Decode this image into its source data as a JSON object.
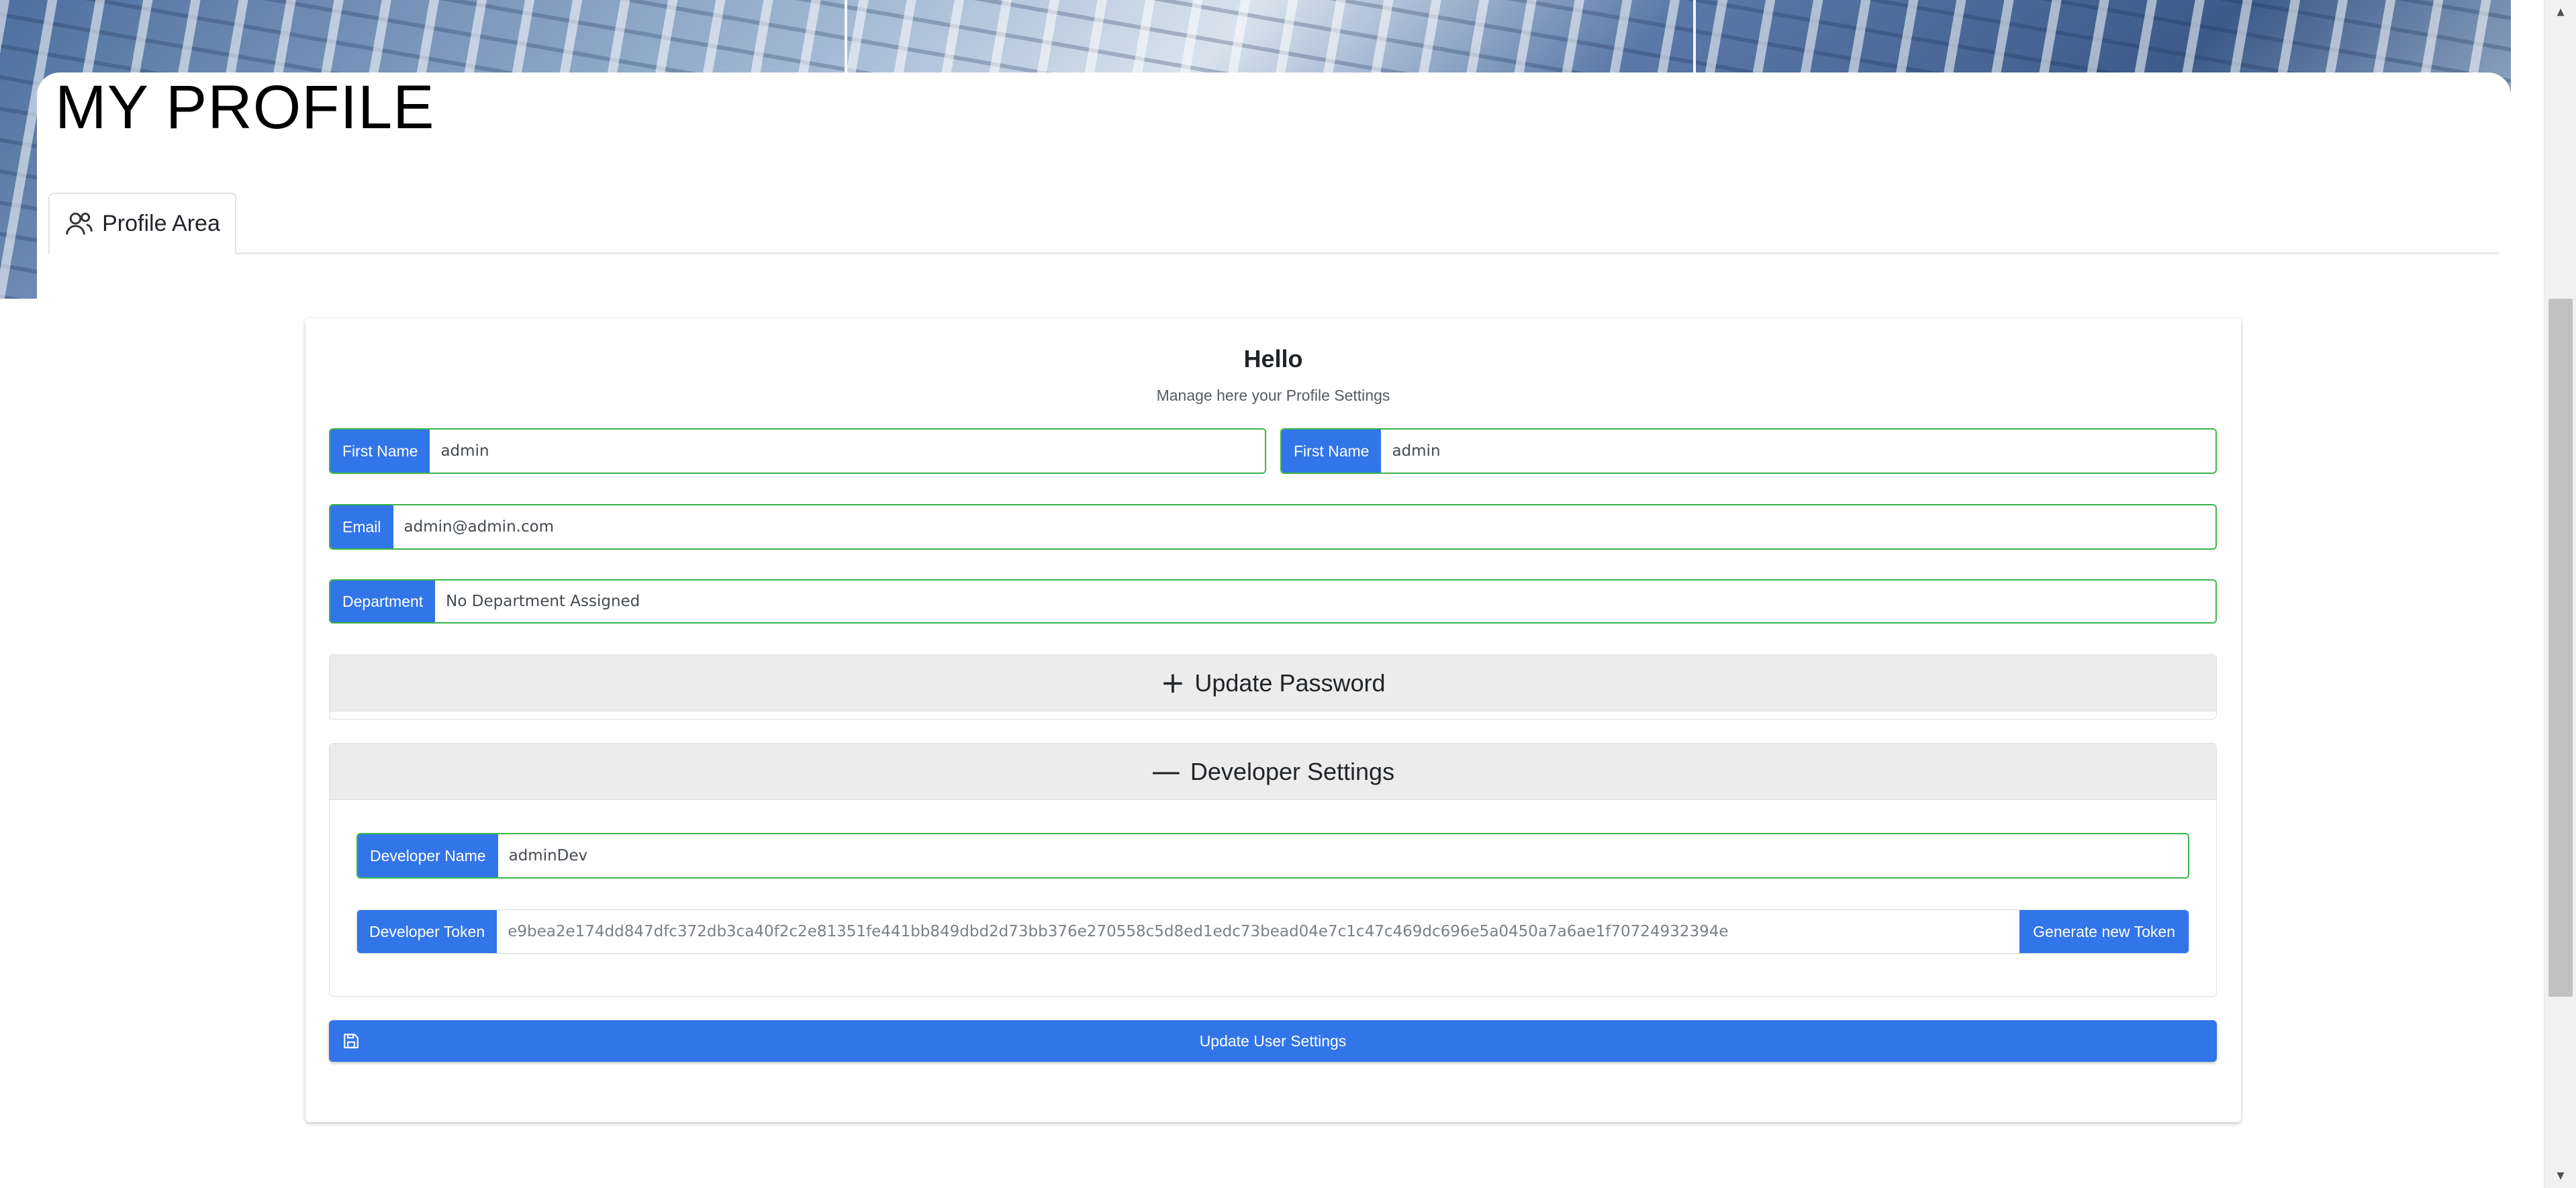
{
  "page": {
    "title": "MY PROFILE"
  },
  "tabs": [
    {
      "label": "Profile Area",
      "icon": "users-icon"
    }
  ],
  "card": {
    "title": "Hello",
    "subtitle": "Manage here your Profile Settings",
    "first_name": {
      "label": "First Name",
      "value": "admin"
    },
    "last_name": {
      "label": "First Name",
      "value": "admin"
    },
    "email": {
      "label": "Email",
      "value": "admin@admin.com"
    },
    "department": {
      "label": "Department",
      "value": "No Department Assigned"
    }
  },
  "accordion": {
    "password": {
      "symbol": "+",
      "label": "Update Password"
    },
    "developer": {
      "symbol": "—",
      "label": "Developer Settings",
      "developer_name": {
        "label": "Developer Name",
        "value": "adminDev"
      },
      "developer_token": {
        "label": "Developer Token",
        "value": "e9bea2e174dd847dfc372db3ca40f2c2e81351fe441bb849dbd2d73bb376e270558c5d8ed1edc73bead04e7c1c47c469dc696e5a0450a7a6ae1f70724932394e",
        "button": "Generate new Token"
      }
    }
  },
  "actions": {
    "submit_label": "Update User Settings",
    "submit_icon": "save-icon"
  },
  "colors": {
    "primary": "#3275e8",
    "valid_border": "#39b54a",
    "accordion_header": "#ececec"
  }
}
